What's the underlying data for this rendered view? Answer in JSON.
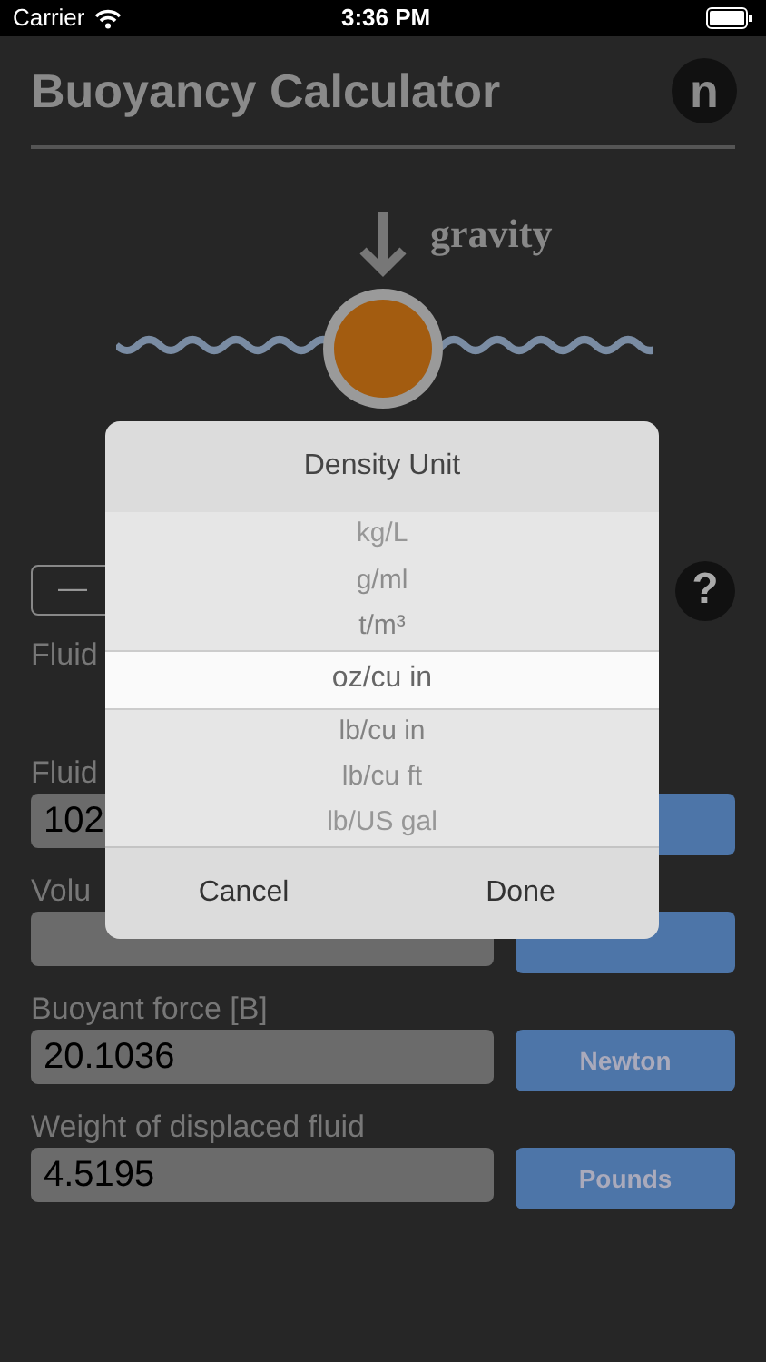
{
  "status_bar": {
    "carrier": "Carrier",
    "time": "3:36 PM"
  },
  "header": {
    "title": "Buoyancy Calculator",
    "logo_letter": "n"
  },
  "illustration": {
    "label": "gravity"
  },
  "controls": {
    "minus": "—",
    "help": "?"
  },
  "rows": [
    {
      "label": "Fluid"
    },
    {
      "label": "Fluid",
      "value": "102",
      "unit_button": true
    },
    {
      "label": "Volu",
      "unit_button": true
    },
    {
      "label": "Buoyant force [B]",
      "value": "20.1036",
      "unit_button": true,
      "unit": "Newton"
    },
    {
      "label": "Weight of displaced fluid",
      "value": "4.5195",
      "unit_button": true,
      "unit": "Pounds"
    }
  ],
  "dialog": {
    "title": "Density Unit",
    "options": [
      {
        "label": "kg/L",
        "selected": false
      },
      {
        "label": "g/ml",
        "selected": false
      },
      {
        "label": "t/m³",
        "selected": false
      },
      {
        "label": "oz/cu in",
        "selected": true
      },
      {
        "label": "lb/cu in",
        "selected": false
      },
      {
        "label": "lb/cu ft",
        "selected": false
      },
      {
        "label": "lb/US gal",
        "selected": false
      }
    ],
    "cancel": "Cancel",
    "done": "Done"
  }
}
